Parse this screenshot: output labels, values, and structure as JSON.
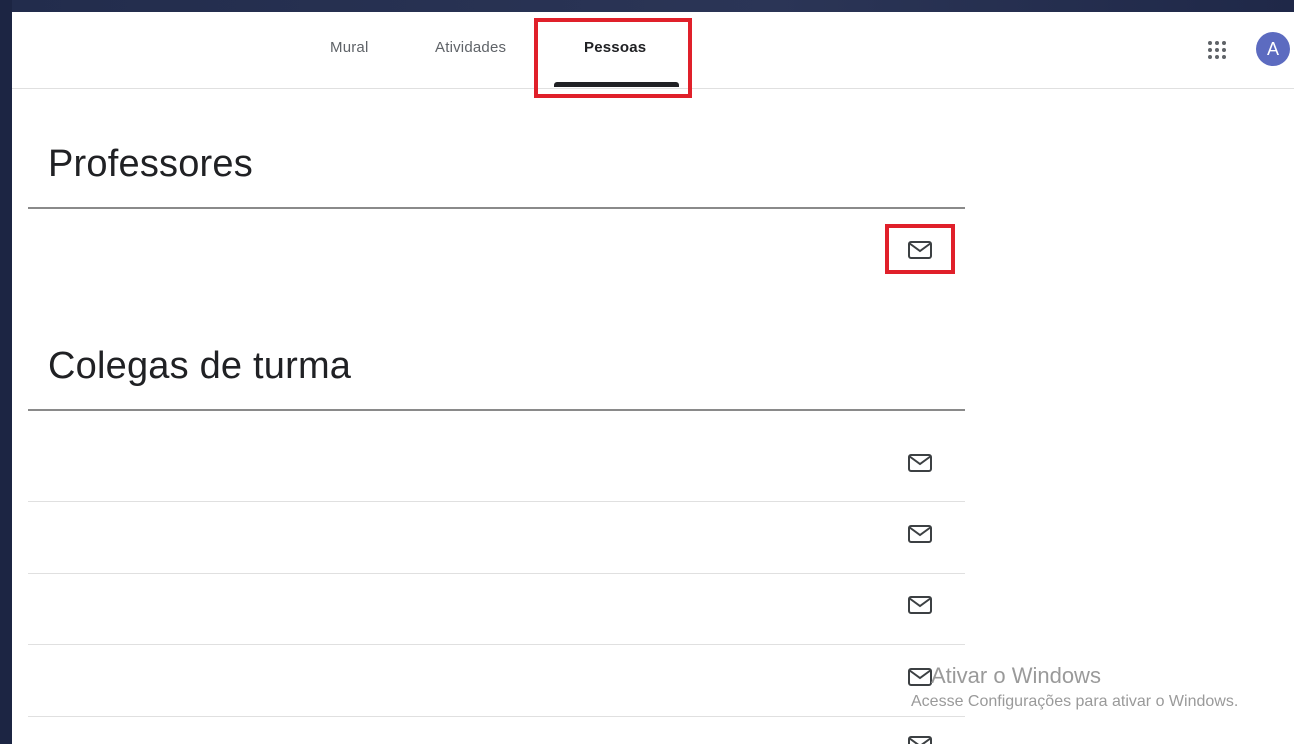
{
  "tabs": [
    {
      "label": "Mural",
      "active": false
    },
    {
      "label": "Atividades",
      "active": false
    },
    {
      "label": "Pessoas",
      "active": true
    }
  ],
  "header": {
    "apps_icon": "apps-grid-icon",
    "avatar_letter": "A",
    "avatar_color": "#5c6bc0"
  },
  "sections": {
    "teachers": {
      "title": "Professores",
      "rows": 1
    },
    "classmates": {
      "title": "Colegas de turma",
      "rows": 5
    }
  },
  "icons": {
    "email": "mail-icon"
  },
  "highlight_color": "#e0202a",
  "watermark": {
    "title": "Ativar o Windows",
    "subtitle": "Acesse Configurações para ativar o Windows."
  }
}
